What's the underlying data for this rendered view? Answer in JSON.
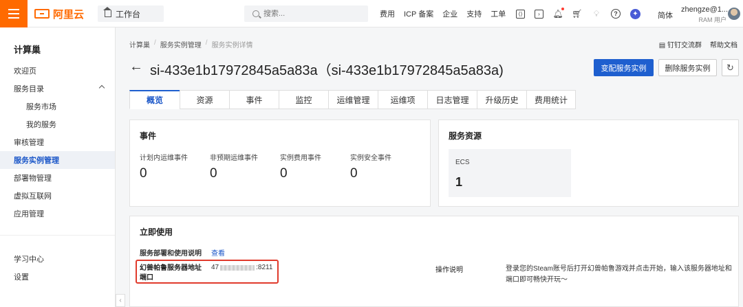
{
  "topbar": {
    "logo_text": "阿里云",
    "workbench_label": "工作台",
    "search_placeholder": "搜索...",
    "nav": [
      "费用",
      "ICP 备案",
      "企业",
      "支持",
      "工单"
    ],
    "icons": [
      "cloud-shell-icon",
      "terminal-icon",
      "bell-icon",
      "cart-icon",
      "lightbulb-icon",
      "help-icon",
      "assistant-icon"
    ],
    "language": "简体",
    "user_name": "zhengze@1...",
    "user_role": "RAM 用户"
  },
  "sidebar": {
    "title": "计算巢",
    "items": [
      {
        "label": "欢迎页",
        "level": 0,
        "active": false
      },
      {
        "label": "服务目录",
        "level": 0,
        "active": false,
        "expandable": true
      },
      {
        "label": "服务市场",
        "level": 1,
        "active": false
      },
      {
        "label": "我的服务",
        "level": 1,
        "active": false
      },
      {
        "label": "审核管理",
        "level": 0,
        "active": false
      },
      {
        "label": "服务实例管理",
        "level": 0,
        "active": true
      },
      {
        "label": "部署物管理",
        "level": 0,
        "active": false
      },
      {
        "label": "虚拟互联网",
        "level": 0,
        "active": false
      },
      {
        "label": "应用管理",
        "level": 0,
        "active": false
      }
    ],
    "bottom_items": [
      {
        "label": "学习中心"
      },
      {
        "label": "设置"
      }
    ]
  },
  "breadcrumb": [
    "计算巢",
    "服务实例管理",
    "服务实例详情"
  ],
  "top_links": {
    "dingtalk": "钉钉交流群",
    "help_docs": "帮助文档"
  },
  "page": {
    "title": "si-433e1b17972845a5a83a（si-433e1b17972845a5a83a)",
    "btn_change": "变配服务实例",
    "btn_delete": "删除服务实例"
  },
  "tabs": [
    {
      "label": "概览",
      "active": true
    },
    {
      "label": "资源",
      "active": false
    },
    {
      "label": "事件",
      "active": false
    },
    {
      "label": "监控",
      "active": false
    },
    {
      "label": "运维管理",
      "active": false
    },
    {
      "label": "运维项",
      "active": false
    },
    {
      "label": "日志管理",
      "active": false
    },
    {
      "label": "升级历史",
      "active": false
    },
    {
      "label": "费用统计",
      "active": false
    }
  ],
  "events_card": {
    "title": "事件",
    "items": [
      {
        "label": "计划内运维事件",
        "value": "0"
      },
      {
        "label": "非预期运维事件",
        "value": "0"
      },
      {
        "label": "实例费用事件",
        "value": "0"
      },
      {
        "label": "实例安全事件",
        "value": "0"
      }
    ]
  },
  "resources_card": {
    "title": "服务资源",
    "label": "ECS",
    "value": "1"
  },
  "use_card": {
    "title": "立即使用",
    "subtitle": "服务部署和使用说明",
    "view_link": "查看",
    "addr_label": "幻兽帕鲁服务器地址端口",
    "addr_prefix": "47",
    "addr_suffix": "8211",
    "op_label": "操作说明",
    "op_desc": "登录您的Steam账号后打开幻兽帕鲁游戏并点击开始，输入该服务器地址和端口即可畅快开玩～"
  },
  "colors": {
    "brand_orange": "#ff6a00",
    "primary_blue": "#1e5fcf",
    "highlight_red": "#e0392b"
  }
}
